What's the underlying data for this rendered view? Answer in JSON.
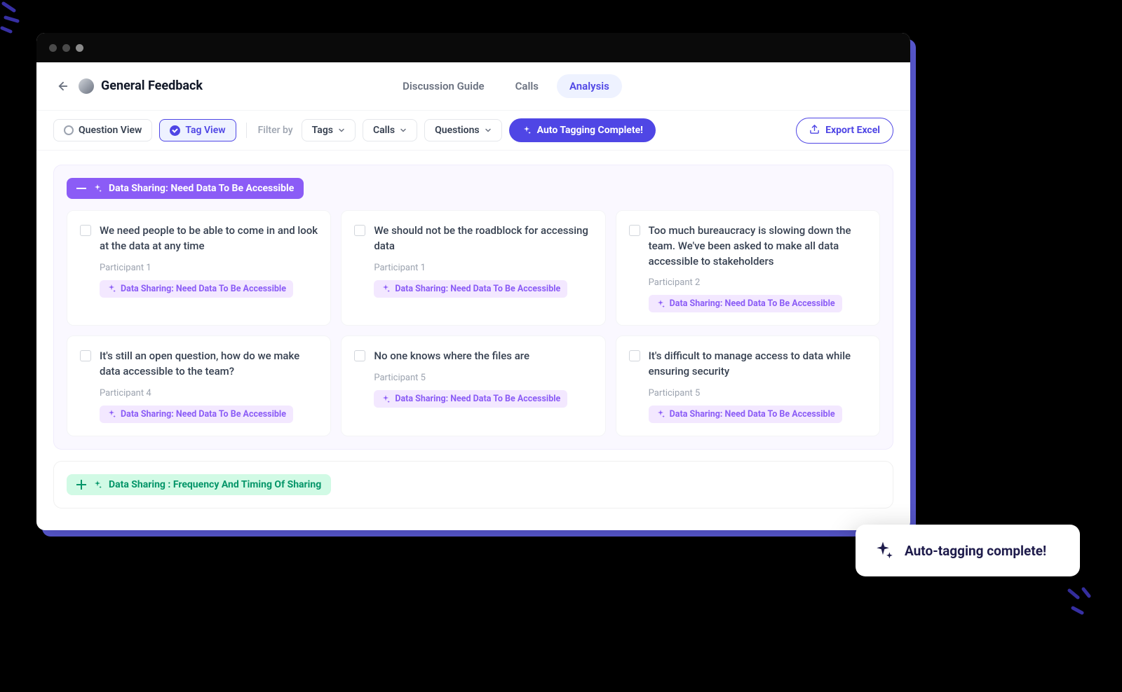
{
  "header": {
    "project_title": "General Feedback",
    "tabs": [
      {
        "label": "Discussion Guide",
        "active": false
      },
      {
        "label": "Calls",
        "active": false
      },
      {
        "label": "Analysis",
        "active": true
      }
    ]
  },
  "toolbar": {
    "question_view": "Question View",
    "tag_view": "Tag View",
    "filter_by_label": "Filter by",
    "filters": [
      "Tags",
      "Calls",
      "Questions"
    ],
    "auto_tag_label": "Auto Tagging Complete!",
    "export_label": "Export Excel"
  },
  "groups": [
    {
      "title": "Data Sharing: Need Data To Be Accessible",
      "expanded": true,
      "color": "purple",
      "cards": [
        {
          "quote": "We need people to be able to come in and look at the data at any time",
          "participant": "Participant 1",
          "tag": "Data Sharing: Need Data To Be Accessible"
        },
        {
          "quote": "We should not be the roadblock for accessing data",
          "participant": "Participant 1",
          "tag": "Data Sharing: Need Data To Be Accessible"
        },
        {
          "quote": "Too much bureaucracy is slowing down the team. We've been asked to make all data accessible to stakeholders",
          "participant": "Participant 2",
          "tag": "Data Sharing: Need Data To Be Accessible"
        },
        {
          "quote": "It's still an open question, how do we make data accessible to the team?",
          "participant": "Participant 4",
          "tag": "Data Sharing: Need Data To Be Accessible"
        },
        {
          "quote": "No one knows where the files are",
          "participant": "Participant 5",
          "tag": "Data Sharing: Need Data To Be Accessible"
        },
        {
          "quote": "It's difficult to manage access to data while ensuring security",
          "participant": "Participant 5",
          "tag": "Data Sharing: Need Data To Be Accessible"
        }
      ]
    },
    {
      "title": "Data Sharing : Frequency And Timing Of Sharing",
      "expanded": false,
      "color": "green"
    }
  ],
  "toast": {
    "text": "Auto-tagging complete!"
  }
}
